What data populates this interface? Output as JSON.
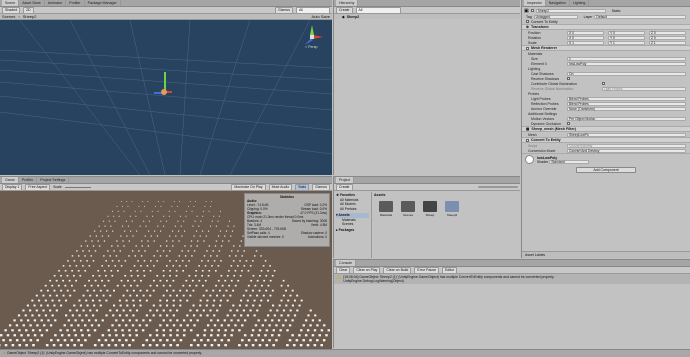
{
  "colors": {
    "scene_bg": "#27435f",
    "game_bg": "#6b5b4e",
    "accent": "#3a72d8"
  },
  "scene_tabs": [
    "Scene",
    "Asset Store",
    "Animator",
    "Profiler",
    "Package Manager"
  ],
  "scene_toolbar": {
    "shading": "Shaded",
    "mode_2d": "2D",
    "gizmos": "Gizmos",
    "search": "All"
  },
  "scene_camera_label": "< Persp",
  "auto_save": "Auto Save",
  "scene_breadcrumb": "Scenes",
  "scene_file": "Sheep2",
  "hierarchy_tab": "Hierarchy",
  "hierarchy_create": "Create",
  "hierarchy_search": "All",
  "hierarchy_item": "Sheep2",
  "game_tabs": [
    "Game",
    "Profiler",
    "Project Settings"
  ],
  "game_toolbar": {
    "display": "Display 1",
    "aspect": "Free Aspect",
    "scale": "Scale",
    "maximize": "Maximize On Play",
    "mute": "Mute Audio",
    "stats": "Stats",
    "gizmos": "Gizmos"
  },
  "stats": {
    "title": "Statistics",
    "audio_header": "Audio:",
    "audio_level": "Level: -74.8 dB",
    "audio_clipping": "Clipping: 0.0%",
    "audio_dsp": "DSP load: 0.2%",
    "audio_stream": "Stream load: 0.0%",
    "graphics_header": "Graphics:",
    "graphics_fps": "47.0 FPS (21.3ms)",
    "cpu": "CPU: main 21.3ms  render thread 0.0ms",
    "batches": "Batches: 4",
    "saved_batches": "Saved by batching: 3008",
    "tris": "Tris: 3.4M",
    "verts": "Verts: 4.8M",
    "screen": "Screen: 332x204 - 793.6KB",
    "setpass": "SetPass calls: 4",
    "shadow_casters": "Shadow casters: 0",
    "visible_skinned": "Visible skinned meshes: 0",
    "animations": "Animations: 0"
  },
  "project_tab": "Project",
  "project_create": "Create",
  "favorites": {
    "title": "Favorites",
    "items": [
      "All Materials",
      "All Models",
      "All Prefabs"
    ]
  },
  "assets": {
    "title": "Assets",
    "items": [
      "Materials",
      "Scenes"
    ]
  },
  "packages": "Packages",
  "assets_path": "Assets",
  "asset_files": [
    "Materials",
    "Scenes",
    "Sheep",
    "Sheep2"
  ],
  "console": {
    "tab": "Console",
    "buttons": [
      "Clear",
      "Clear on Play",
      "Clear on Build",
      "Error Pause",
      "Editor"
    ],
    "message1": "[15:08:04] GameObject 'Sheep2 (1)' (UnityEngine.GameObject) has multiple ConvertToEntity components and cannot be converted properly.",
    "message2": "UnityEngine.Debug:LogWarning(Object)"
  },
  "inspector": {
    "tabs": [
      "Inspector",
      "Navigation",
      "Lighting"
    ],
    "object_name": "Sheep2",
    "static_label": "Static",
    "tag_label": "Tag",
    "tag_value": "Untagged",
    "layer_label": "Layer",
    "layer_value": "Default",
    "convert_to_entity": "Convert To Entity",
    "transform": {
      "title": "Transform",
      "rows": [
        {
          "label": "Position",
          "x": "X 0",
          "y": "Y 0",
          "z": "Z 0"
        },
        {
          "label": "Rotation",
          "x": "X 0",
          "y": "Y 0",
          "z": "Z 0"
        },
        {
          "label": "Scale",
          "x": "X 1",
          "y": "Y 1",
          "z": "Z 1"
        }
      ]
    },
    "mesh_renderer": {
      "title": "Mesh Renderer",
      "materials_header": "Materials",
      "size_label": "Size",
      "size_value": "1",
      "element0_label": "Element 0",
      "element0_value": "lowLowPoly",
      "lighting_header": "Lighting",
      "cast_shadows_label": "Cast Shadows",
      "cast_shadows_value": "On",
      "receive_shadows_label": "Receive Shadows",
      "contribute_gi_label": "Contribute Global Illumination",
      "receive_gi_label": "Receive Global Illumination",
      "receive_gi_value": "Light Probes",
      "probes_header": "Probes",
      "light_probes_label": "Light Probes",
      "light_probes_value": "Blend Probes",
      "reflection_probes_label": "Reflection Probes",
      "reflection_probes_value": "Blend Probes",
      "anchor_override_label": "Anchor Override",
      "anchor_override_value": "None (Transform)",
      "additional_header": "Additional Settings",
      "motion_vectors_label": "Motion Vectors",
      "motion_vectors_value": "Per Object Motion",
      "dynamic_occlusion_label": "Dynamic Occlusion"
    },
    "mesh_filter": {
      "title": "Sheep_mesh (Mesh Filter)",
      "mesh_label": "Mesh",
      "mesh_value": "SheepLowPo"
    },
    "convert_component": {
      "title": "Convert To Entity",
      "script_label": "Script",
      "script_value": "ConvertToEntity",
      "mode_label": "Conversion Mode",
      "mode_value": "Convert And Destroy"
    },
    "material": {
      "name": "lowLowPoly",
      "shader_label": "Shader",
      "shader_value": "Standard"
    },
    "add_component": "Add Component"
  },
  "asset_labels": "Asset Labels",
  "status_bar": "GameObject 'Sheep2 (1)' (UnityEngine.GameObject) has multiple ConvertToEntity components and cannot be converted properly."
}
